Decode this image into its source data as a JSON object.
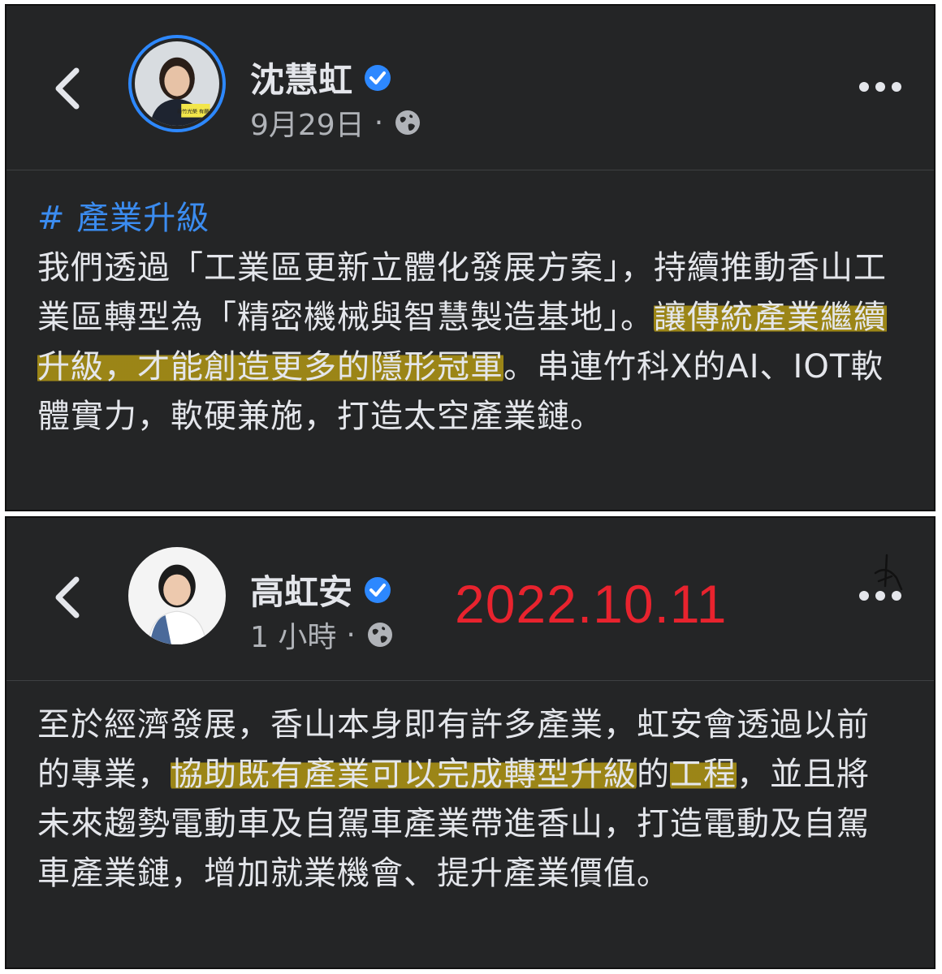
{
  "post1": {
    "author": "沈慧虹",
    "timestamp": "9月29日",
    "separator": "·",
    "avatar_caption": "新竹光榮 有願景",
    "hashtag": "# 產業升級",
    "body_part1": "我們透過「工業區更新立體化發展方案」，持續推動香山工業區轉型為「精密機械與智慧製造基地」。",
    "body_highlight": "讓傳統產業繼續升級，才能創造更多的隱形冠軍",
    "body_part2": "。串連竹科X的AI、IOT軟體實力，軟硬兼施，打造太空產業鏈。"
  },
  "post2": {
    "author": "高虹安",
    "timestamp": "1 小時",
    "separator": "·",
    "date_stamp": "2022.10.11",
    "body_part1": "至於經濟發展，香山本身即有許多產業，虹安會透過以前的專業，",
    "body_highlight": "協助既有產業可以完成轉型升級",
    "body_mid": "的",
    "body_highlight2": "工程",
    "body_part2": "，並且將未來趨勢電動車及自駕車產業帶進香山，打造電動及自駕車產業鏈，增加就業機會、提升產業價值。"
  },
  "icons": {
    "back": "chevron-left-icon",
    "verified": "verified-badge-icon",
    "privacy": "globe-icon",
    "more": "more-horizontal-icon"
  },
  "colors": {
    "panel_bg": "#242526",
    "text": "#e4e6eb",
    "muted": "#b0b3b8",
    "link": "#3b8cf0",
    "verified": "#2d88ff",
    "highlight": "#b09614",
    "date_stamp": "#e8232e"
  }
}
